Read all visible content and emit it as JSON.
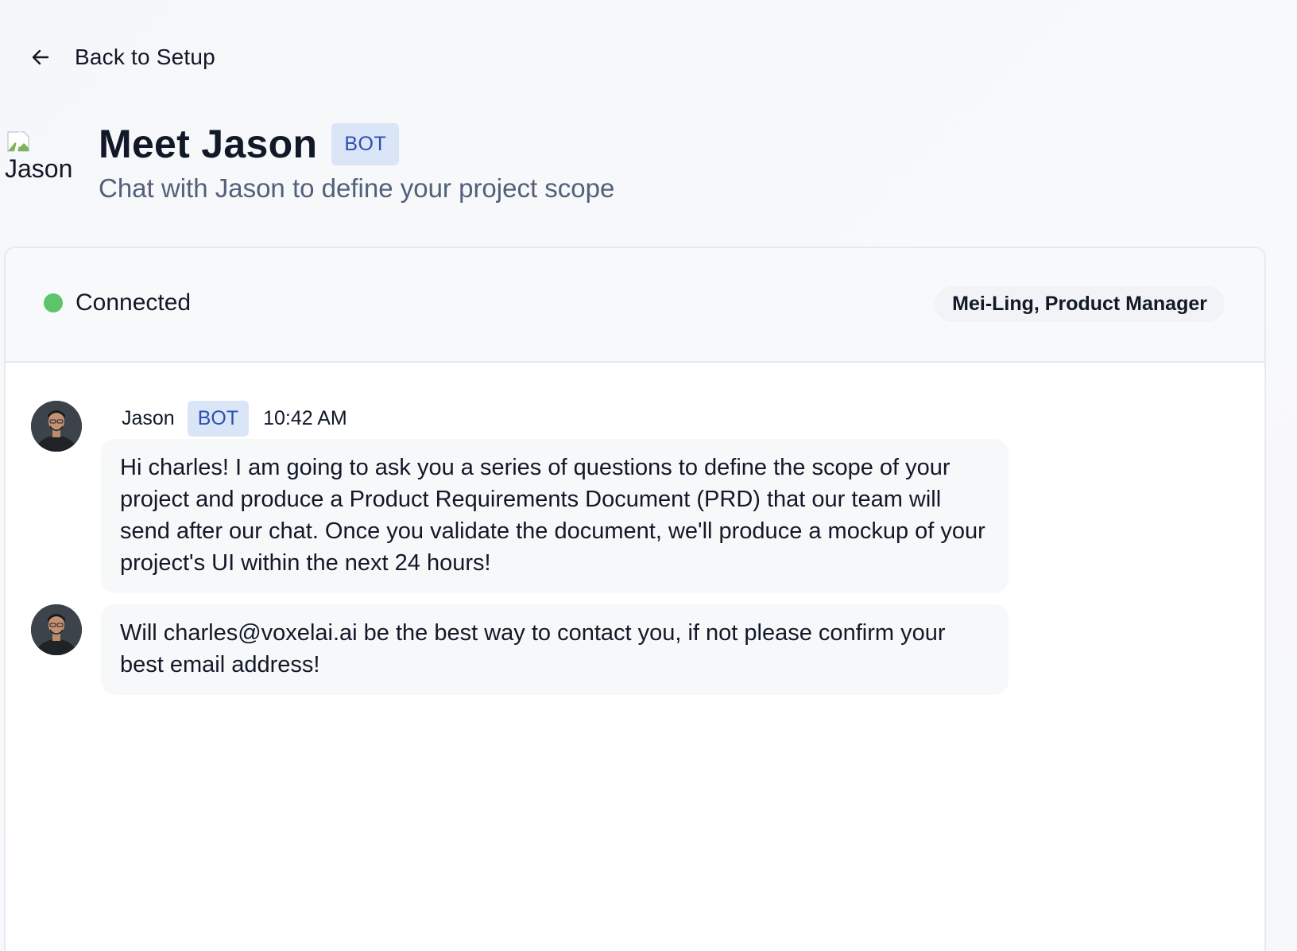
{
  "nav": {
    "back_label": "Back to Setup",
    "back_icon": "arrow-left-icon"
  },
  "header": {
    "avatar_alt": "Jason",
    "title": "Meet Jason",
    "badge": "BOT",
    "subtitle": "Chat with Jason to define your project scope"
  },
  "chat": {
    "status_label": "Connected",
    "status_color": "#5ec46a",
    "user_label": "Mei-Ling, Product Manager",
    "messages": [
      {
        "author": "Jason",
        "badge": "BOT",
        "time": "10:42 AM",
        "text": "Hi charles! I am going to ask you a series of questions to define the scope of your project and produce a Product Requirements Document (PRD) that our team will send after our chat. Once you validate the document, we'll produce a mockup of your project's UI within the next 24 hours!"
      },
      {
        "text": "Will charles@voxelai.ai be the best way to contact you, if not please confirm your best email address!"
      }
    ]
  },
  "colors": {
    "accent_badge_bg": "#dbe5f8",
    "accent_badge_text": "#2b4fb0"
  }
}
